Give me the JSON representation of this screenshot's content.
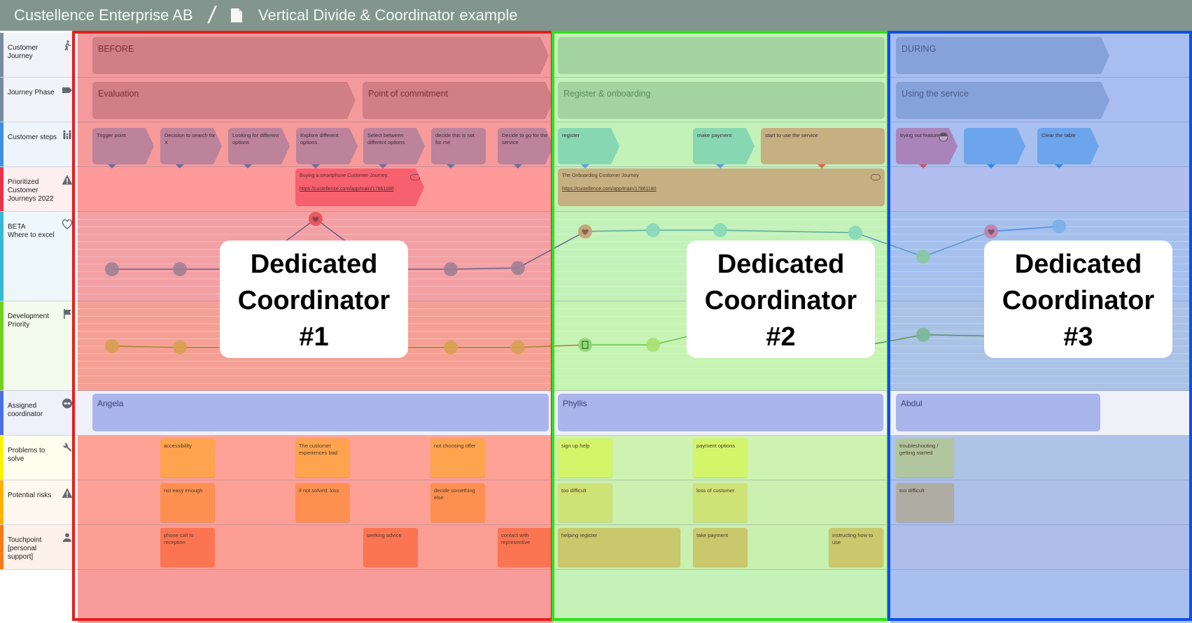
{
  "header": {
    "org": "Custellence Enterprise AB",
    "separator": "/",
    "doc_icon": "document-icon",
    "title": "Vertical Divide & Coordinator example"
  },
  "lanes": [
    {
      "label": "Customer\nJourney",
      "icon": "walking-person-icon",
      "stripe": "#7a8aa0",
      "bg": "#f1f3f8"
    },
    {
      "label": "Journey Phase",
      "icon": "tag-icon",
      "stripe": "#7a8aa0",
      "bg": "#f1f3f8"
    },
    {
      "label": "Customer steps",
      "icon": "family-icon",
      "stripe": "#3f8fe0",
      "bg": "#eef4fb"
    },
    {
      "label": "Prioritized\nCustomer\nJourneys 2022",
      "icon": "warning-icon",
      "stripe": "#e8334a",
      "bg": "#fdeef0"
    },
    {
      "label": "BETA\nWhere to excel",
      "icon": "heart-outline-icon",
      "stripe": "#36b9d6",
      "bg": "#eef8fc"
    },
    {
      "label": "Development\nPriority",
      "icon": "flag-icon",
      "stripe": "#6fd11c",
      "bg": "#f3fbec"
    },
    {
      "label": "Assigned\ncoordinator",
      "icon": "coordinator-mask-icon",
      "stripe": "#4a6fe0",
      "bg": "#eef0fa"
    },
    {
      "label": "Problems to solve",
      "icon": "wrench-icon",
      "stripe": "#fff200",
      "bg": "#fffdee"
    },
    {
      "label": "Potential risks",
      "icon": "warning-icon",
      "stripe": "#ffb300",
      "bg": "#fff8ee"
    },
    {
      "label": "Touchpoint\n[personal\nsupport]",
      "icon": "person-icon",
      "stripe": "#f57a1a",
      "bg": "#fdf1ea"
    }
  ],
  "sections": [
    {
      "name": "before",
      "frame_color": "#e81c1c",
      "journey": "BEFORE",
      "phases": [
        "Evaluation",
        "Point of commitment"
      ],
      "steps": [
        "Trigger point",
        "Decision to search for X",
        "Looking for different options",
        "Explore different options",
        "Select between different options",
        "decide this is not for me",
        "Decide to go for the service"
      ],
      "prioritized": {
        "title": "Buying a smartphone Customer Journey:",
        "url": "https://custellence.com/app/main/17861180"
      },
      "coordinator": "Angela",
      "problems": [
        "accessibility",
        "The customer experiences bad",
        "not choosing offer"
      ],
      "risks": [
        "not easy enough",
        "if not solved: loss",
        "decide something else"
      ],
      "touchpoints": [
        "phone call to reception",
        "seeking advice",
        "contact with representive"
      ],
      "callout": {
        "line1": "Dedicated",
        "line2": "Coordinator",
        "line3": "#1"
      }
    },
    {
      "name": "onboarding",
      "frame_color": "#2ee01a",
      "journey": "",
      "phases": [
        "Register & onboarding"
      ],
      "steps": [
        "register",
        "make payment",
        "start to use the service"
      ],
      "prioritized": {
        "title": "The Onboarding Customer Journey",
        "url": "https://custellence.com/app/main/17861180"
      },
      "coordinator": "Phyllis",
      "problems": [
        "sign up help",
        "payment options"
      ],
      "risks": [
        "too difficult",
        "loss of customer"
      ],
      "touchpoints": [
        "helping register",
        "take payment",
        "instructing how to use"
      ],
      "callout": {
        "line1": "Dedicated",
        "line2": "Coordinator",
        "line3": "#2"
      }
    },
    {
      "name": "during",
      "frame_color": "#0d4fe8",
      "journey": "DURING",
      "phases": [
        "Using the service"
      ],
      "steps": [
        "trying out feature A",
        "",
        "Clear the table"
      ],
      "coordinator": "Abdul",
      "problems": [
        "troubleshooting / getting started"
      ],
      "risks": [
        "too difficult"
      ],
      "touchpoints": [],
      "callout": {
        "line1": "Dedicated",
        "line2": "Coordinator",
        "line3": "#3"
      }
    }
  ],
  "chart_data": [
    {
      "type": "line",
      "title": "BETA Where to excel",
      "xlabel": "",
      "ylabel": "",
      "categories": [
        "Trigger point",
        "Decision to search for X",
        "Looking for different options",
        "Explore different options",
        "Select between different options",
        "decide this is not for me",
        "Decide to go for the service",
        "register",
        "",
        "make payment",
        "start to use the service",
        "trying out feature A",
        "",
        "Clear the table"
      ],
      "values": [
        1,
        1,
        1,
        3,
        1,
        1,
        1.05,
        2.5,
        2.55,
        2.55,
        2.45,
        1.5,
        2.5,
        2.7
      ],
      "ylim": [
        0,
        3
      ],
      "point_icons": [
        "",
        "",
        "",
        "heart",
        "",
        "",
        "",
        "heart",
        "",
        "",
        "",
        "",
        "heart",
        ""
      ]
    },
    {
      "type": "line",
      "title": "Development Priority",
      "xlabel": "",
      "ylabel": "",
      "categories": [
        "Trigger point",
        "Decision to search for X",
        "Looking for different options",
        "Explore different options",
        "Select between different options",
        "decide this is not for me",
        "Decide to go for the service",
        "register",
        "",
        "make payment",
        "start to use the service",
        "trying out feature A",
        "",
        "Clear the table"
      ],
      "values": [
        1.5,
        1.45,
        1.45,
        1.9,
        1.45,
        1.45,
        1.45,
        1.55,
        1.55,
        2.2,
        1.45,
        1.95,
        1.9,
        1.85
      ],
      "ylim": [
        0,
        3
      ],
      "point_icons": [
        "",
        "",
        "",
        "",
        "",
        "",
        "",
        "calendar",
        "",
        "",
        "",
        "",
        "",
        ""
      ]
    }
  ]
}
